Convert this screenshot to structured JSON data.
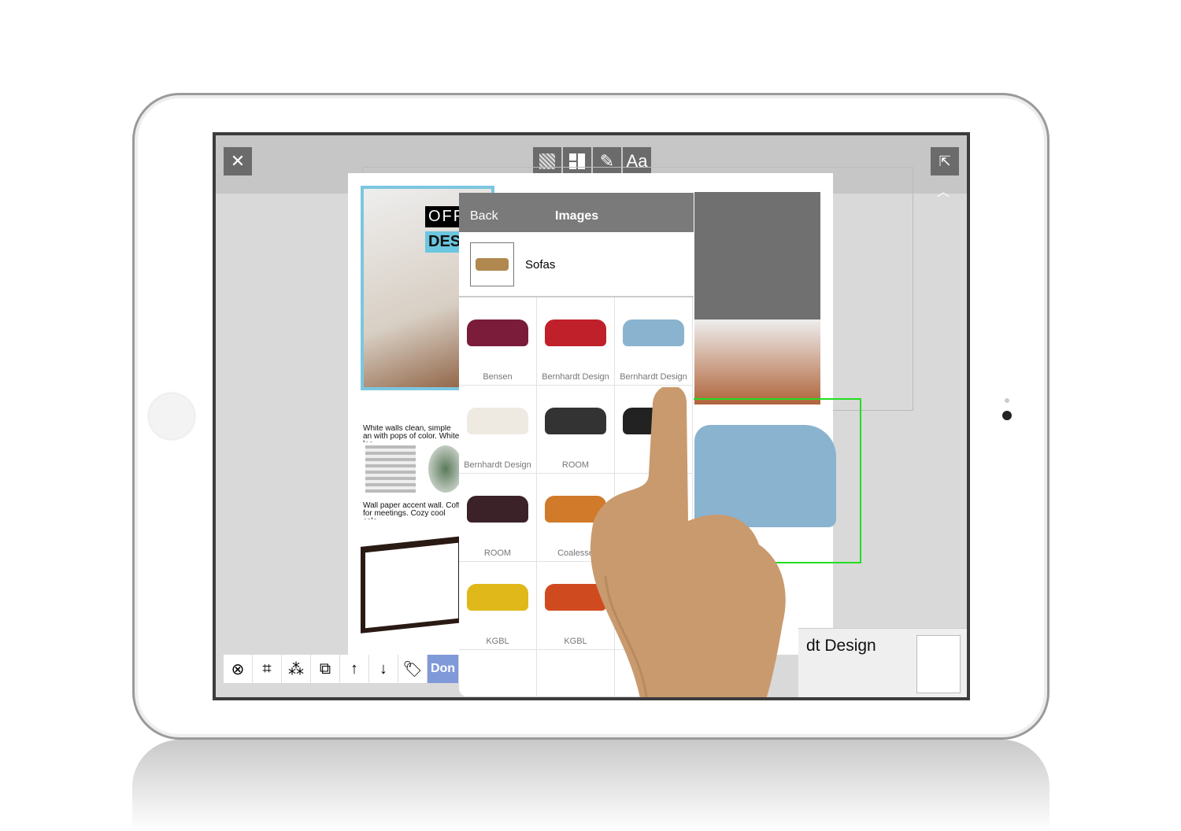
{
  "toolbar": {
    "close_icon": "close-icon",
    "mode_icons": [
      "texture-icon",
      "layout-icon",
      "pencil-icon",
      "text-icon"
    ],
    "text_label": "Aa",
    "share_icon": "share-icon",
    "collapse_icon": "chevron-up-icon"
  },
  "popover": {
    "back_label": "Back",
    "title": "Images",
    "category": "Sofas",
    "items": [
      {
        "label": "Bensen",
        "color": "#7a1c3a"
      },
      {
        "label": "Bernhardt Design",
        "color": "#c0202a"
      },
      {
        "label": "Bernhardt Design",
        "color": "#8ab3cf"
      },
      {
        "label": "Bernhardt Design",
        "color": "#eeeae2"
      },
      {
        "label": "ROOM",
        "color": "#333333"
      },
      {
        "label": "",
        "color": "#222222"
      },
      {
        "label": "ROOM",
        "color": "#3a2228"
      },
      {
        "label": "Coalesse",
        "color": "#d07a2a"
      },
      {
        "label": "",
        "color": "#c9b89a"
      },
      {
        "label": "KGBL",
        "color": "#e0b81a"
      },
      {
        "label": "KGBL",
        "color": "#d04a20"
      },
      {
        "label": "",
        "color": "#b02040"
      }
    ]
  },
  "board": {
    "title1": "OFF",
    "title2": "DES",
    "caption1": "White walls clean, simple an with pops of color. White lac",
    "caption2": "Wall paper accent wall. Coff for meetings. Cozy cool colo",
    "product_label": "dt Design"
  },
  "bottom_toolbar": {
    "icons": [
      "remove-icon",
      "crop-icon",
      "magic-wand-icon",
      "duplicate-icon",
      "bring-forward-icon",
      "send-backward-icon",
      "tag-icon"
    ],
    "glyphs": [
      "⊗",
      "⌗",
      "⁂",
      "⧉",
      "↑",
      "↓",
      "🏷"
    ],
    "done_label": "Don"
  },
  "colors": {
    "accent": "#8099d8",
    "selection": "#22dd22",
    "header": "#7a7a7a"
  }
}
